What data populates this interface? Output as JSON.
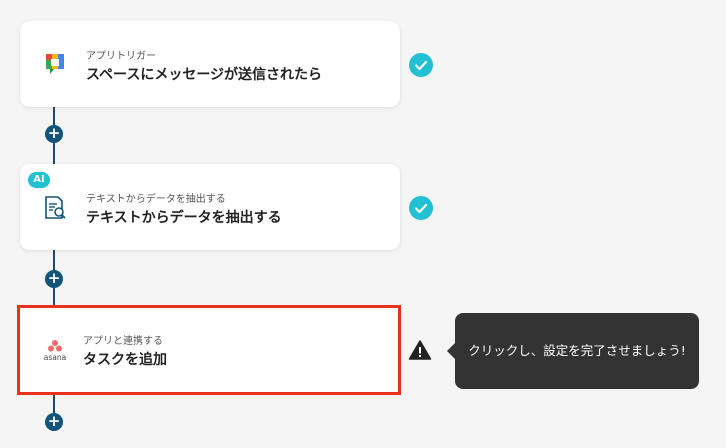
{
  "steps": [
    {
      "subtitle": "アプリトリガー",
      "title": "スペースにメッセージが送信されたら",
      "status": "completed",
      "icon": "google-chat-icon"
    },
    {
      "badge": "AI",
      "subtitle": "テキストからデータを抽出する",
      "title": "テキストからデータを抽出する",
      "status": "completed",
      "icon": "document-search-icon"
    },
    {
      "subtitle": "アプリと連携する",
      "title": "タスクを追加",
      "status": "warning",
      "icon": "asana-logo",
      "logo_text": "asana"
    }
  ],
  "tooltip": {
    "text": "クリックし、設定を完了させましょう!"
  },
  "add_step_label": "+",
  "colors": {
    "accent": "#22c0d4",
    "connector": "#1e4a68",
    "add_button": "#13557a",
    "selected_border": "#e8321e",
    "tooltip_bg": "#333333"
  }
}
